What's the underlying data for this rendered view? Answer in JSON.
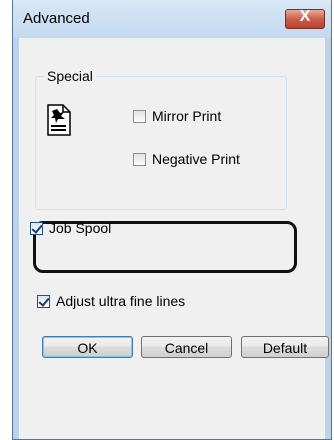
{
  "window": {
    "title": "Advanced",
    "close_label": "X"
  },
  "special_group": {
    "legend": "Special",
    "icon": "printer-icon",
    "mirror_print": {
      "label": "Mirror Print",
      "checked": false
    },
    "negative_print": {
      "label": "Negative Print",
      "checked": false
    }
  },
  "job_spool": {
    "label": "Job Spool",
    "checked": true
  },
  "adjust_fine_lines": {
    "label": "Adjust ultra fine lines",
    "checked": true
  },
  "buttons": {
    "ok": "OK",
    "cancel": "Cancel",
    "default": "Default"
  },
  "colors": {
    "frame": "#bcd2ea",
    "client": "#f0f0f0",
    "close_button": "#c85a45",
    "highlight_border": "#111111"
  }
}
